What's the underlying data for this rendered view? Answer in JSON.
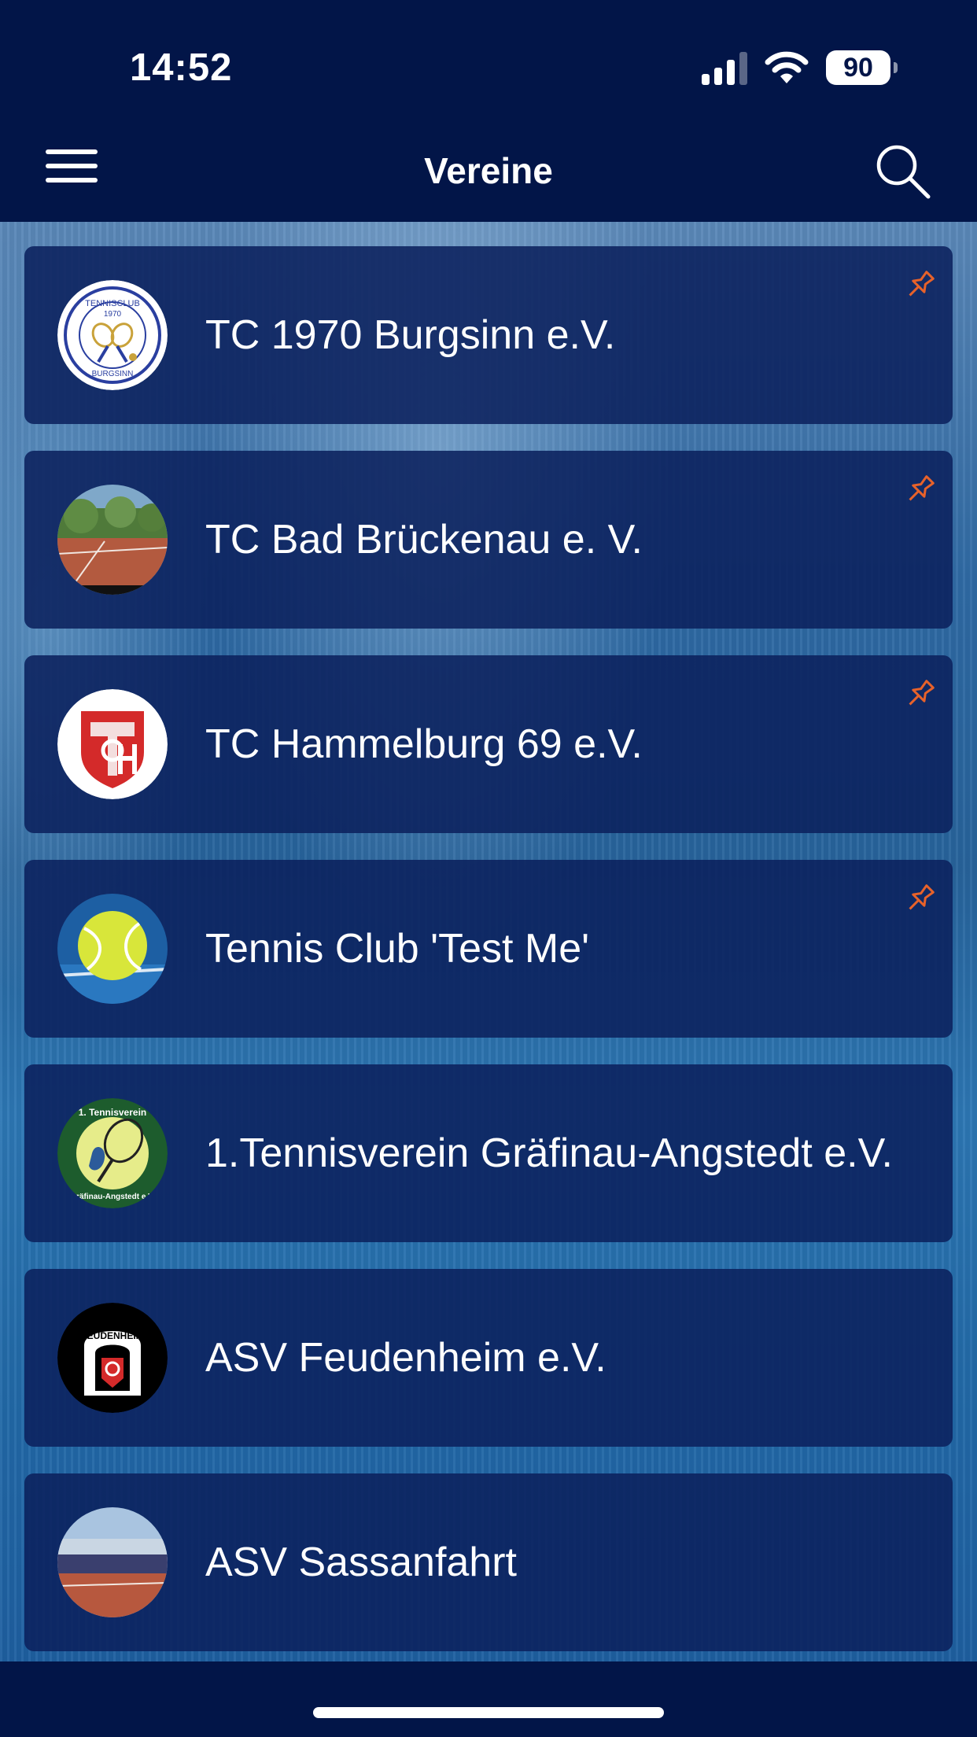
{
  "status_bar": {
    "time": "14:52",
    "battery": "90"
  },
  "header": {
    "title": "Vereine"
  },
  "accent_color": "#e8622a",
  "clubs": [
    {
      "name": "TC 1970 Burgsinn e.V.",
      "pinned": true,
      "logo": "tennisclub-burgsinn-logo",
      "logo_text": {
        "top": "TENNISCLUB",
        "year": "1970",
        "bottom": "BURGSINN"
      }
    },
    {
      "name": "TC Bad Brückenau e. V.",
      "pinned": true,
      "logo": "tennis-court-photo"
    },
    {
      "name": "TC Hammelburg 69 e.V.",
      "pinned": true,
      "logo": "tc-hammelburg-crest"
    },
    {
      "name": "Tennis Club 'Test Me'",
      "pinned": true,
      "logo": "tennis-ball-photo"
    },
    {
      "name": "1.Tennisverein Gräfinau-Angstedt e.V.",
      "pinned": false,
      "logo": "tennisverein-graefinau-logo",
      "logo_text": {
        "top": "1. Tennisverein",
        "bottom": "Gräfinau-Angstedt e.V."
      }
    },
    {
      "name": "ASV Feudenheim e.V.",
      "pinned": false,
      "logo": "asv-feudenheim-logo",
      "logo_text": {
        "arc": "FEUDENHEIM"
      }
    },
    {
      "name": "ASV Sassanfahrt",
      "pinned": false,
      "logo": "tennis-facility-photo"
    }
  ]
}
